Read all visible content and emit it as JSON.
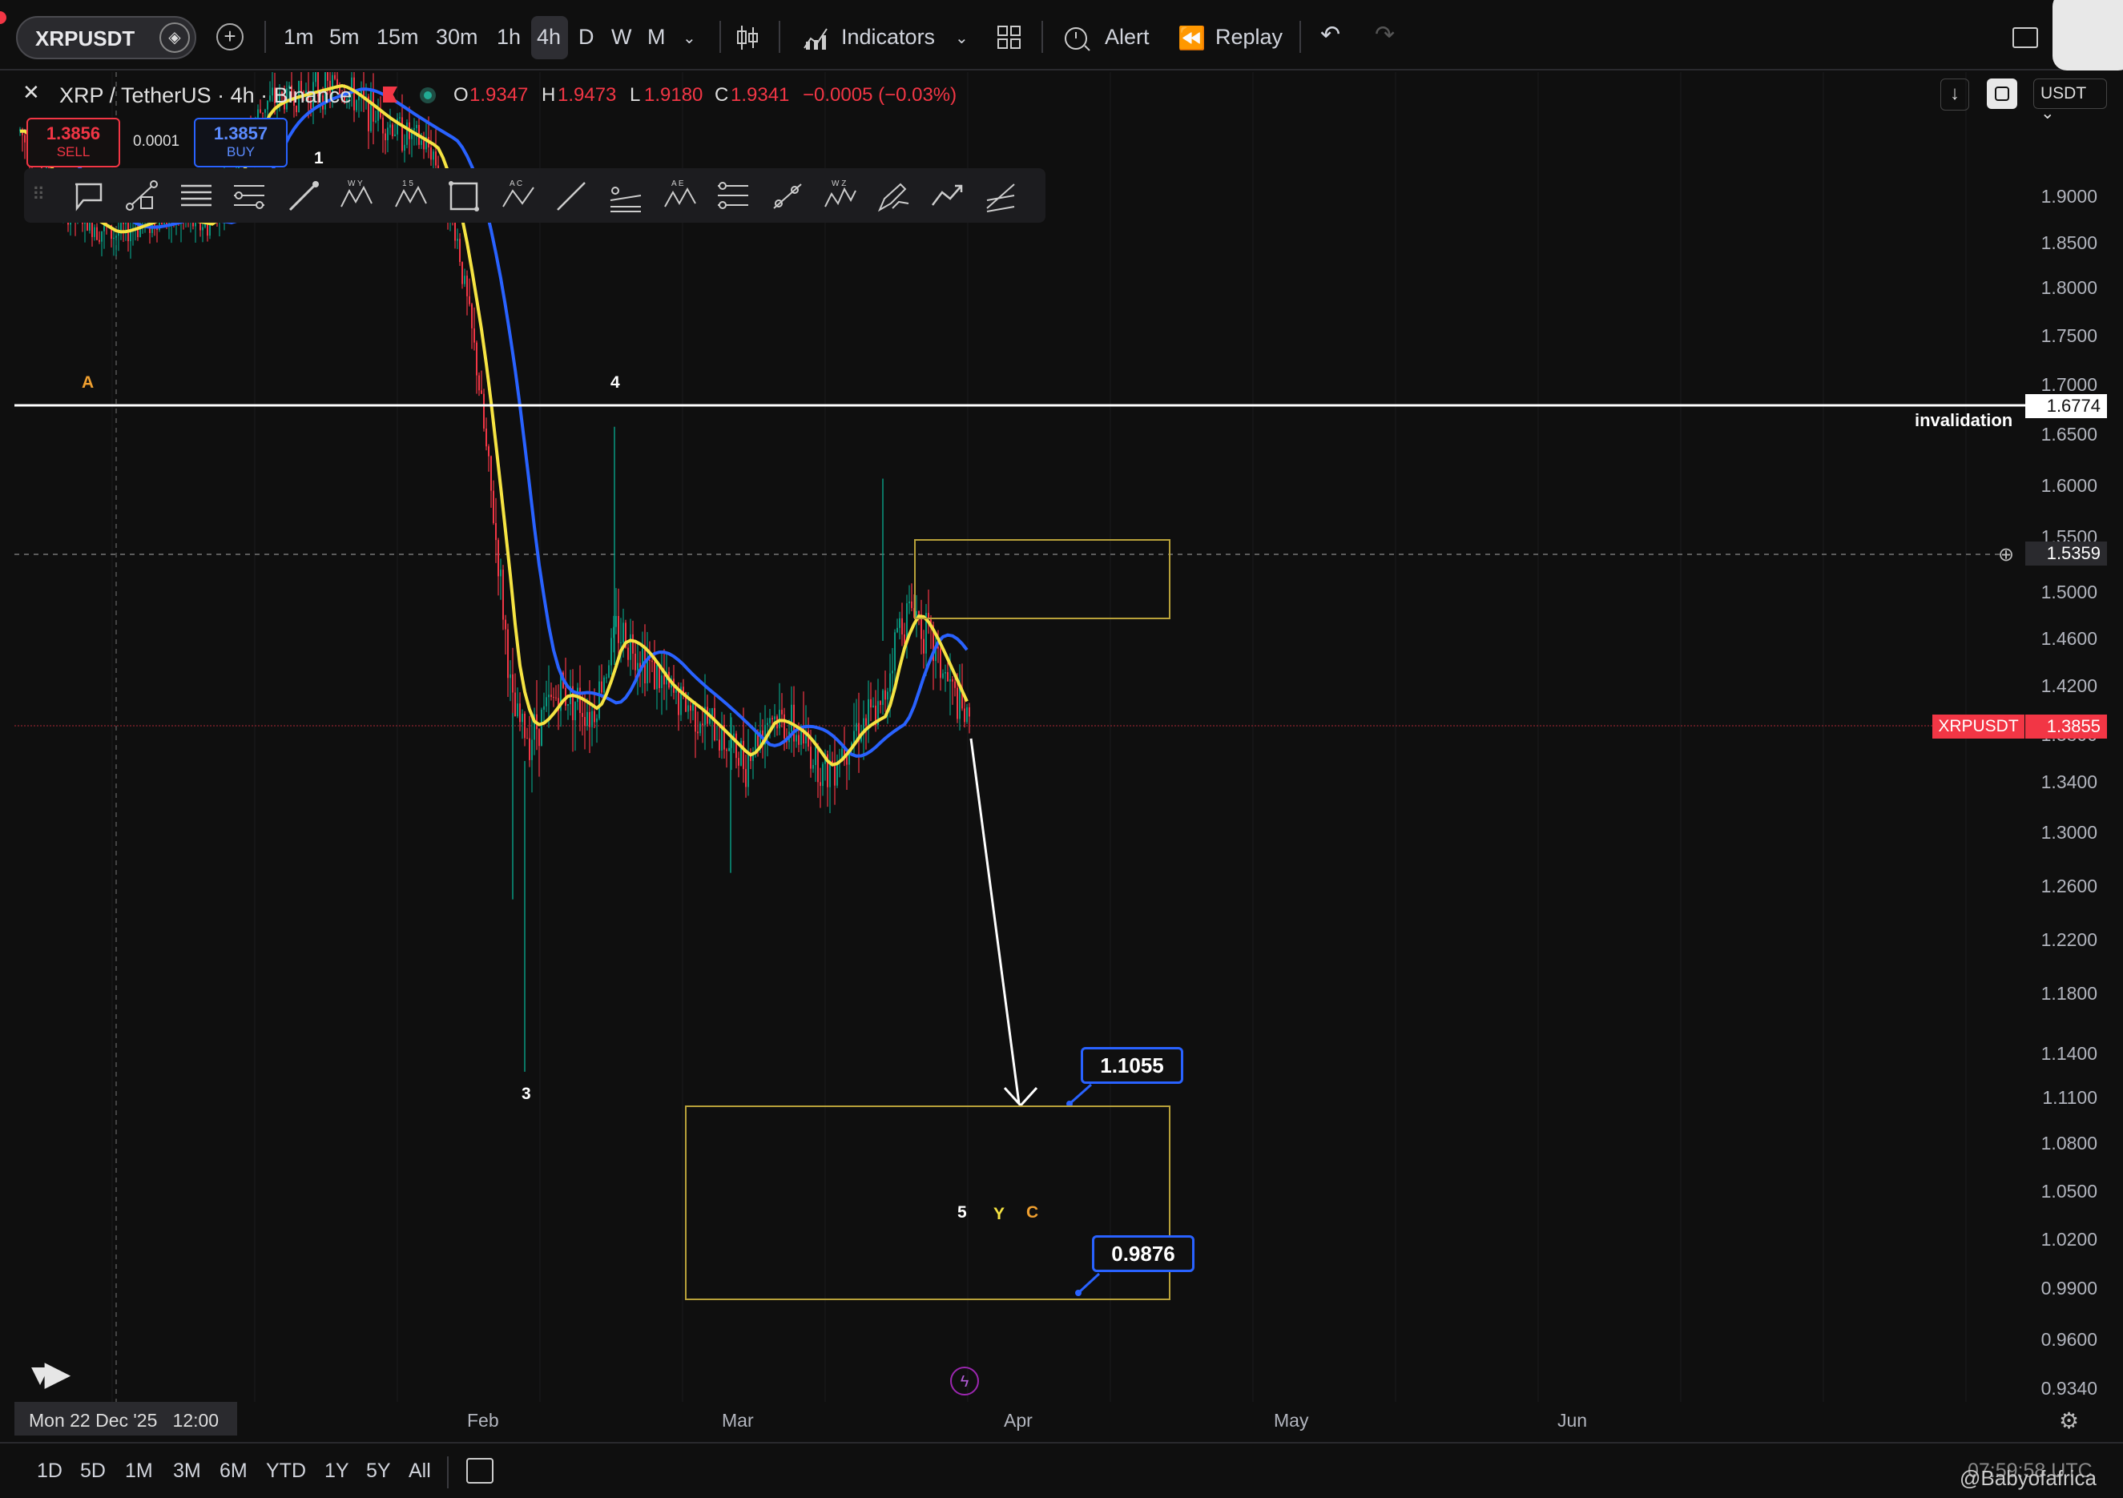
{
  "toolbar": {
    "symbol": "XRPUSDT",
    "timeframes": [
      "1m",
      "5m",
      "15m",
      "30m",
      "1h",
      "4h",
      "D",
      "W",
      "M"
    ],
    "active_timeframe": "4h",
    "indicators_label": "Indicators",
    "alert_label": "Alert",
    "replay_label": "Replay"
  },
  "legend": {
    "title": "XRP / TetherUS · 4h · Binance",
    "o_label": "O",
    "o_value": "1.9347",
    "h_label": "H",
    "h_value": "1.9473",
    "l_label": "L",
    "l_value": "1.9180",
    "c_label": "C",
    "c_value": "1.9341",
    "change": "−0.0005 (−0.03%)"
  },
  "trade": {
    "sell_price": "1.3856",
    "sell_label": "SELL",
    "spread": "0.0001",
    "buy_price": "1.3857",
    "buy_label": "BUY"
  },
  "currency": "USDT",
  "price_axis": [
    "1.9000",
    "1.8500",
    "1.8000",
    "1.7500",
    "1.7000",
    "1.6500",
    "1.6000",
    "1.5500",
    "1.5000",
    "1.4600",
    "1.4200",
    "1.3800",
    "1.3400",
    "1.3000",
    "1.2600",
    "1.2200",
    "1.1800",
    "1.1400",
    "1.1100",
    "1.0800",
    "1.0500",
    "1.0200",
    "0.9900",
    "0.9600",
    "0.9340"
  ],
  "time_axis": {
    "crosshair_date": "Mon 22 Dec '25   12:00",
    "months": [
      "Feb",
      "Mar",
      "Apr",
      "May",
      "Jun"
    ]
  },
  "annotations": {
    "invalidation_label": "invalidation",
    "invalidation_price": "1.6774",
    "crosshair_price": "1.5359",
    "last_symbol": "XRPUSDT",
    "last_price": "1.3855",
    "target_high": "1.1055",
    "target_low": "0.9876",
    "wave_labels": [
      "A",
      "1",
      "4",
      "3",
      "5",
      "Y",
      "C"
    ]
  },
  "bottom": {
    "ranges": [
      "1D",
      "5D",
      "1M",
      "3M",
      "6M",
      "YTD",
      "1Y",
      "5Y",
      "All"
    ],
    "clock": "07:59:58 UTC",
    "watermark": "@Babyofafrica"
  },
  "colors": {
    "background": "#0f0f0f",
    "ma_fast": "#f5e342",
    "ma_slow": "#2962ff",
    "down": "#f23645",
    "up": "#089981",
    "zone": "#b8a13a"
  },
  "chart_data": {
    "type": "line",
    "series": [
      {
        "x": [
          "Dec 22",
          "Jan 5",
          "Jan 15",
          "Jan 25",
          "Feb 1",
          "Feb 5",
          "Feb 10",
          "Feb 15",
          "Feb 22",
          "Mar 1",
          "Mar 8",
          "Mar 15",
          "Mar 18",
          "Mar 22",
          "Mar 24"
        ],
        "values": [
          1.9,
          1.92,
          2.05,
          1.95,
          1.65,
          1.4,
          1.42,
          1.47,
          1.4,
          1.38,
          1.36,
          1.4,
          1.49,
          1.42,
          1.39
        ]
      }
    ],
    "projection": {
      "from": 1.3855,
      "to": 1.1055
    },
    "ylim": [
      0.934,
      1.93
    ]
  }
}
